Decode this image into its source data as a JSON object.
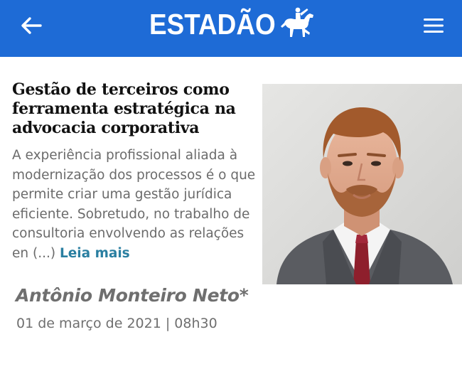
{
  "header": {
    "brand": "ESTADÃO",
    "back_icon": "arrow-left-icon",
    "menu_icon": "hamburger-menu-icon",
    "logo_icon": "horse-rider-icon",
    "background_color": "#1e6bd6"
  },
  "article": {
    "title": "Gestão de terceiros como ferramenta estratégica na advocacia corporativa",
    "summary": "A experiência profissional aliada à modernização dos processos é o que permite criar uma gestão jurídica eficiente. Sobretudo, no trabalho de consultoria envolvendo as relações en (...)",
    "read_more": "Leia mais",
    "read_more_color": "#2a7fa1",
    "author": "Antônio Monteiro Neto*",
    "date": "01 de março de 2021 | 08h30"
  }
}
